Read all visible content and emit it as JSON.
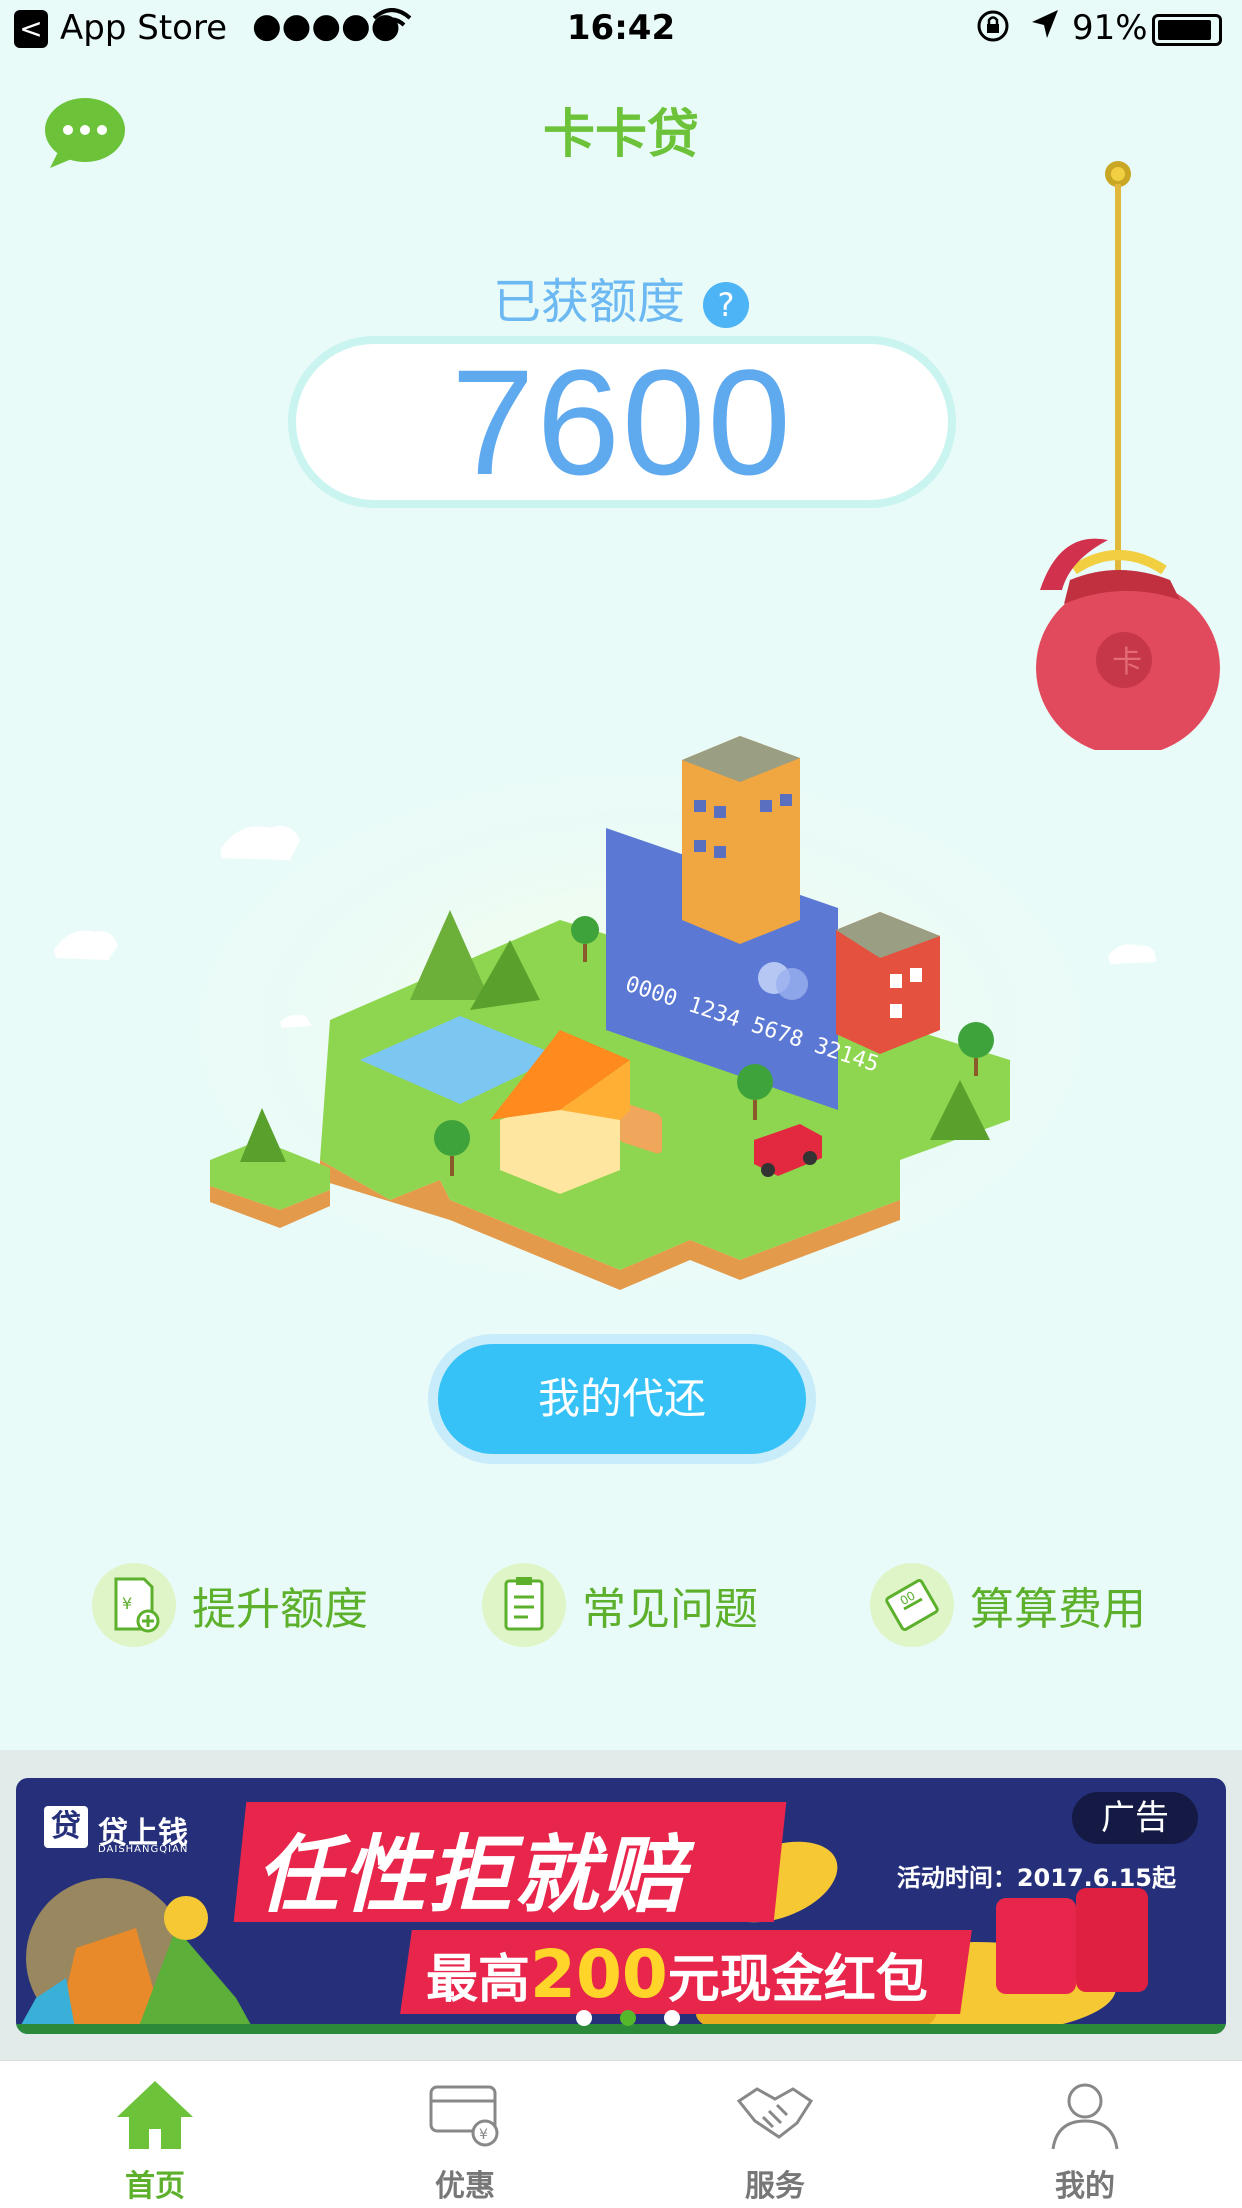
{
  "status_bar": {
    "back_glyph": "<",
    "carrier": "App Store",
    "signal": "●●●●●",
    "time": "16:42",
    "battery_percent": "91%",
    "battery_level": 0.91
  },
  "header": {
    "title": "卡卡贷",
    "chat_icon": "chat-bubble-icon"
  },
  "credit": {
    "label": "已获额度",
    "help_glyph": "?",
    "amount": "7600"
  },
  "scene": {
    "card_number": "0000 1234 5678 32145"
  },
  "primary_action": {
    "label": "我的代还"
  },
  "features": [
    {
      "label": "提升额度",
      "icon": "raise-limit-icon"
    },
    {
      "label": "常见问题",
      "icon": "faq-clipboard-icon"
    },
    {
      "label": "算算费用",
      "icon": "fee-calculator-icon"
    }
  ],
  "ad": {
    "brand": "贷上钱",
    "brand_icon_glyph": "贷",
    "brand_sub": "DAISHANGQIAN",
    "tag": "广告",
    "date": "活动时间：2017.6.15起",
    "headline": "任性拒就赔",
    "sub_prefix": "最高",
    "sub_amount": "200",
    "sub_suffix": "元现金红包",
    "slides": 3,
    "active_slide": 1
  },
  "tabs": [
    {
      "label": "首页",
      "icon": "home-icon",
      "active": true
    },
    {
      "label": "优惠",
      "icon": "coupon-icon",
      "active": false
    },
    {
      "label": "服务",
      "icon": "handshake-icon",
      "active": false
    },
    {
      "label": "我的",
      "icon": "profile-icon",
      "active": false
    }
  ],
  "colors": {
    "background": "#e9fbf9",
    "brand_green": "#6cc33a",
    "accent_blue": "#36c2f6",
    "credit_blue": "#5fa9ee",
    "ad_red": "#e8264b",
    "ad_navy": "#26307a"
  }
}
